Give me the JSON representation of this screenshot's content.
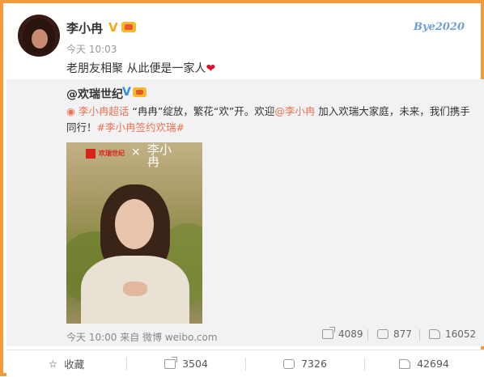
{
  "post": {
    "author": "李小冉",
    "verified_mark": "V",
    "time": "今天 10:03",
    "text": "老朋友相聚 从此便是一家人",
    "heart": "❤",
    "watermark": "Bye2020"
  },
  "repost": {
    "author": "@欢瑞世纪",
    "verified_mark": "V",
    "supertopic_icon": "◉",
    "supertopic": "李小冉超话",
    "text_1": " “冉冉”绽放，繁花“欢”开。欢迎",
    "mention": "@李小冉",
    "text_2": " 加入欢瑞大家庭，未来，我们携手同行！",
    "hashtag": "#李小冉签约欢瑞#",
    "image": {
      "brand": "欢瑞世纪",
      "cross": "×",
      "name": "李小冉"
    },
    "meta": "今天 10:00 来自 微博 weibo.com",
    "stats": {
      "forward": "4089",
      "comment": "877",
      "like": "16052"
    }
  },
  "bottom_bar": {
    "favorite": "收藏",
    "forward": "3504",
    "comment": "7326",
    "like": "42694"
  },
  "colors": {
    "frame": "#f39a3c",
    "link": "#eb7350",
    "verified_gold": "#f2a81b",
    "verified_blue": "#2f8fe8"
  }
}
